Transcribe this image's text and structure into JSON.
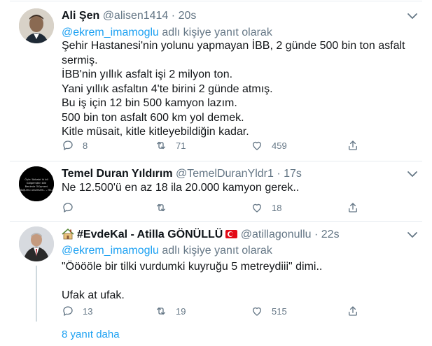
{
  "tweets": [
    {
      "name": "Ali Şen",
      "handle": "@alisen1414",
      "dot": "·",
      "time": "20s",
      "reply_prefix": "@ekrem_imamoglu",
      "reply_suffix": "adlı kişiye yanıt olarak",
      "lines": [
        "Şehir Hastanesi'nin yolunu yapmayan İBB, 2 günde 500 bin ton asfalt",
        "sermiş.",
        "İBB'nin yıllık asfalt işi 2 milyon ton.",
        "Yani yıllık asfaltın 4'te birini 2 günde atmış.",
        "Bu iş için 12 bin 500 kamyon lazım.",
        "500 bin ton asfalt 600 km yol demek.",
        "Kitle müsait, kitle kitleyebildiğin kadar."
      ],
      "replies": "8",
      "retweets": "71",
      "likes": "459"
    },
    {
      "name": "Temel Duran Yıldırım",
      "handle": "@TemelDuranYldr1",
      "dot": "·",
      "time": "17s",
      "lines": [
        "Ne 12.500'ü en az 18 ila 20.000 kamyon gerek.."
      ],
      "replies": "",
      "retweets": "",
      "likes": "18",
      "avatar_text": "Öyle 'Akbabı' ki bil Gölgemden bile Benimle Ölüşmeni olduğumu unutmam. – Hz.Ali"
    },
    {
      "name": "#EvdeKal - Atilla GÖNÜLLÜ",
      "handle": "@atillagonullu",
      "dot": "·",
      "time": "22s",
      "reply_prefix": "@ekrem_imamoglu",
      "reply_suffix": "adlı kişiye yanıt olarak",
      "lines": [
        "\"Ööööle bir tilki vurdumki kuyruğu 5 metreydiii\" dimi..",
        "",
        "Ufak at ufak."
      ],
      "replies": "13",
      "retweets": "19",
      "likes": "515"
    }
  ],
  "show_more_label": "8 yanıt daha",
  "icons": {
    "reply": "reply-icon",
    "retweet": "retweet-icon",
    "like": "heart-icon",
    "share": "share-icon",
    "more": "chevron-down-icon",
    "flag": "turkey-flag-icon",
    "house": "house-icon"
  },
  "colors": {
    "accent": "#1da1f2",
    "muted": "#657786",
    "text": "#14171a",
    "divider": "#e6ecf0",
    "flag_red": "#e30a17"
  }
}
